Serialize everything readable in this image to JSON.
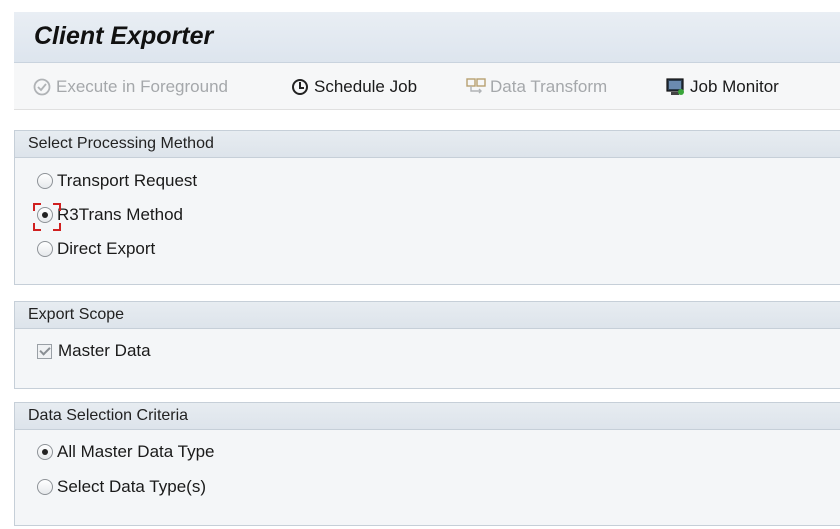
{
  "app": {
    "title": "Client Exporter"
  },
  "toolbar": {
    "execute_label": "Execute in Foreground",
    "schedule_label": "Schedule Job",
    "transform_label": "Data Transform",
    "monitor_label": "Job Monitor"
  },
  "processing": {
    "title": "Select Processing Method",
    "options": [
      "Transport Request",
      "R3Trans Method",
      "Direct Export"
    ],
    "selected": "R3Trans Method"
  },
  "scope": {
    "title": "Export Scope",
    "master_data_label": "Master Data",
    "master_data_checked": true
  },
  "criteria": {
    "title": "Data Selection Criteria",
    "options": [
      "All Master Data Type",
      "Select Data Type(s)"
    ],
    "selected": "All Master Data Type"
  },
  "colors": {
    "header_bg": "#dde5ee",
    "group_bg": "#f4f6f8",
    "disabled_text": "#a5a8ab",
    "focus_marker": "#d02020"
  }
}
